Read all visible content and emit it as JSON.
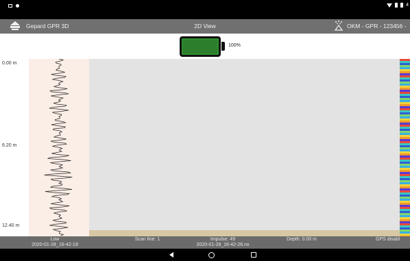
{
  "app": {
    "name": "Gepard GPR 3D",
    "view_title": "2D View",
    "device": "OKM - GPR - 123456 -"
  },
  "battery": {
    "percent_label": "100%",
    "level": 1.0
  },
  "depth_axis": {
    "labels": [
      "0.00 m",
      "6.20 m",
      "12.40 m"
    ]
  },
  "info": {
    "gain": "Low",
    "file_date": "2020-01-28_16-42-19",
    "scan_line": "Scan line: 1",
    "impulse": "Impulse: 49",
    "file_name": "2020-01-28_16-42-26.nx",
    "depth": "Depth: 0.00 m",
    "gps": "GPS disabl"
  },
  "colors": {
    "trace_bg": "#fbeee6",
    "scan_bg": "#e3e3e3",
    "ground": "#d8c7a4",
    "battery_fill": "#2c7d2c"
  },
  "icons": {
    "app_logo": "gpr-device-icon",
    "device": "satellite-probe-icon",
    "back": "back-icon",
    "home": "home-icon",
    "recent": "recent-apps-icon"
  }
}
